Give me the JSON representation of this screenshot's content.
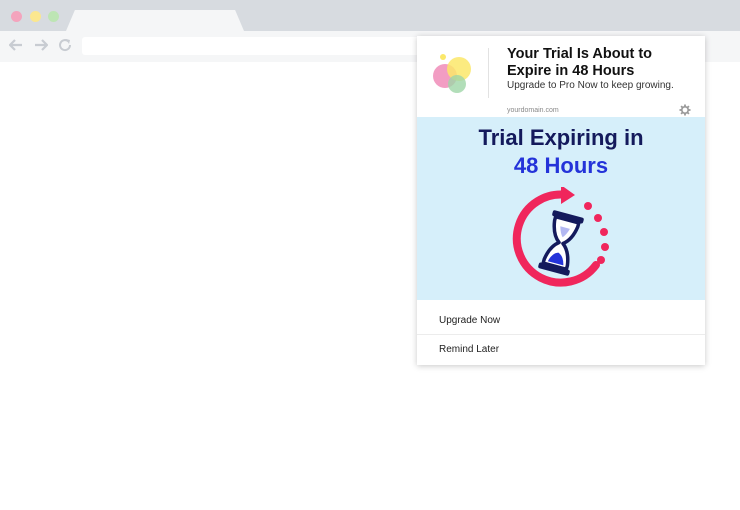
{
  "notification": {
    "title": "Your Trial Is About to Expire in 48 Hours",
    "subtitle": "Upgrade to Pro Now to keep growing.",
    "domain": "yourdomain.com",
    "banner": {
      "line1": "Trial Expiring in",
      "line2": "48 Hours"
    },
    "actions": [
      {
        "label": "Upgrade Now"
      },
      {
        "label": "Remind Later"
      }
    ]
  },
  "colors": {
    "banner_bg": "#d6effa",
    "heading_dark": "#141a5c",
    "heading_accent": "#2433d9",
    "timer_ring": "#f0265c"
  },
  "icons": {
    "back": "arrow-left-icon",
    "forward": "arrow-right-icon",
    "reload": "reload-icon",
    "settings": "gear-icon",
    "timer": "hourglass-icon"
  }
}
